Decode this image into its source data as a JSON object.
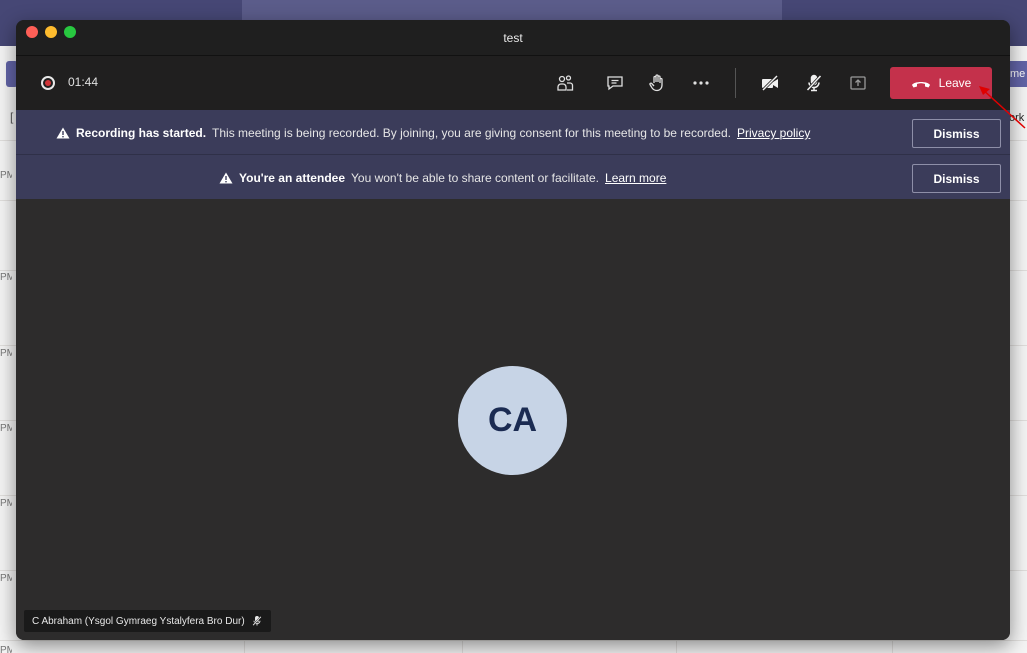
{
  "window": {
    "title": "test"
  },
  "background": {
    "right_button_text": "me",
    "right_text": "ork",
    "left_bracket": "[",
    "time_fragments": [
      "PM",
      "PM",
      "PM",
      "PM",
      "PM",
      "PM",
      "PM"
    ]
  },
  "toolbar": {
    "timer": "01:44",
    "icons": [
      "people-icon",
      "chat-icon",
      "raise-hand-icon",
      "more-icon",
      "camera-off-icon",
      "mic-off-icon",
      "share-icon"
    ],
    "leave_label": "Leave"
  },
  "banners": [
    {
      "title": "Recording has started.",
      "message": "This meeting is being recorded. By joining, you are giving consent for this meeting to be recorded.",
      "link": "Privacy policy",
      "dismiss": "Dismiss"
    },
    {
      "title": "You're an attendee",
      "message": "You won't be able to share content or facilitate.",
      "link": "Learn more",
      "dismiss": "Dismiss"
    }
  ],
  "participant": {
    "initials": "CA",
    "name": "C Abraham (Ysgol Gymraeg Ystalyfera Bro Dur)"
  },
  "colors": {
    "leave": "#c4314b",
    "banner": "#3b3c5a",
    "avatar_bg": "#c7d4e6",
    "avatar_text": "#1b2b52"
  }
}
